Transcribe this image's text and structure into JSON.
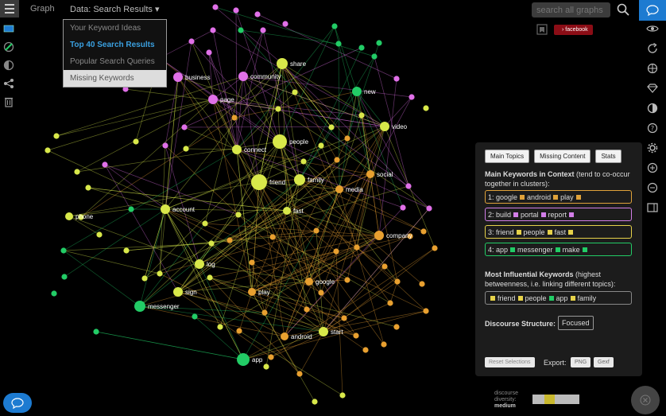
{
  "topbar": {
    "graph_tab": "Graph",
    "data_tab": "Data: Search Results ▾",
    "search_placeholder": "search all graphs"
  },
  "dropdown": {
    "items": [
      "Your Keyword Ideas",
      "Top 40 Search Results",
      "Popular Search Queries",
      "Missing Keywords"
    ]
  },
  "facebook_tag": "› facebook",
  "panel": {
    "tabs": [
      "Main Topics",
      "Missing Content",
      "Stats"
    ],
    "keywords_heading": "Main Keywords in Context",
    "keywords_note": "(tend to co-occur together in clusters):",
    "topics": [
      {
        "label": "1: google",
        "words": [
          "android",
          "play"
        ],
        "color": "#e0a23a"
      },
      {
        "label": "2: build",
        "words": [
          "portal",
          "report"
        ],
        "color": "#d27ee8"
      },
      {
        "label": "3: friend",
        "words": [
          "people",
          "fast"
        ],
        "color": "#e6d24a"
      },
      {
        "label": "4: app",
        "words": [
          "messenger",
          "make"
        ],
        "color": "#22cc66"
      }
    ],
    "influential_heading": "Most Influential Keywords",
    "influential_note": "(highest betweenness, i.e. linking different topics):",
    "influential": [
      "friend",
      "people",
      "app",
      "family"
    ],
    "discourse_label": "Discourse Structure:",
    "discourse_value": "Focused",
    "reset_label": "Reset Selections",
    "export_label": "Export:",
    "export_png": "PNG",
    "export_gexf": "Gexf"
  },
  "diversity": {
    "line1": "discourse",
    "line2": "diversity:",
    "line3": "medium"
  },
  "graph": {
    "labels": [
      "share",
      "business",
      "community",
      "page",
      "new",
      "video",
      "people",
      "connect",
      "friend",
      "family",
      "social",
      "media",
      "account",
      "phone",
      "fast",
      "company",
      "log",
      "google",
      "sign",
      "play",
      "messenger",
      "android",
      "start",
      "app"
    ]
  },
  "colors": {
    "pink": "#e070e8",
    "green": "#22cc66",
    "yellow": "#d8e84a",
    "orange": "#e8a030",
    "accent": "#1d7bd1"
  }
}
